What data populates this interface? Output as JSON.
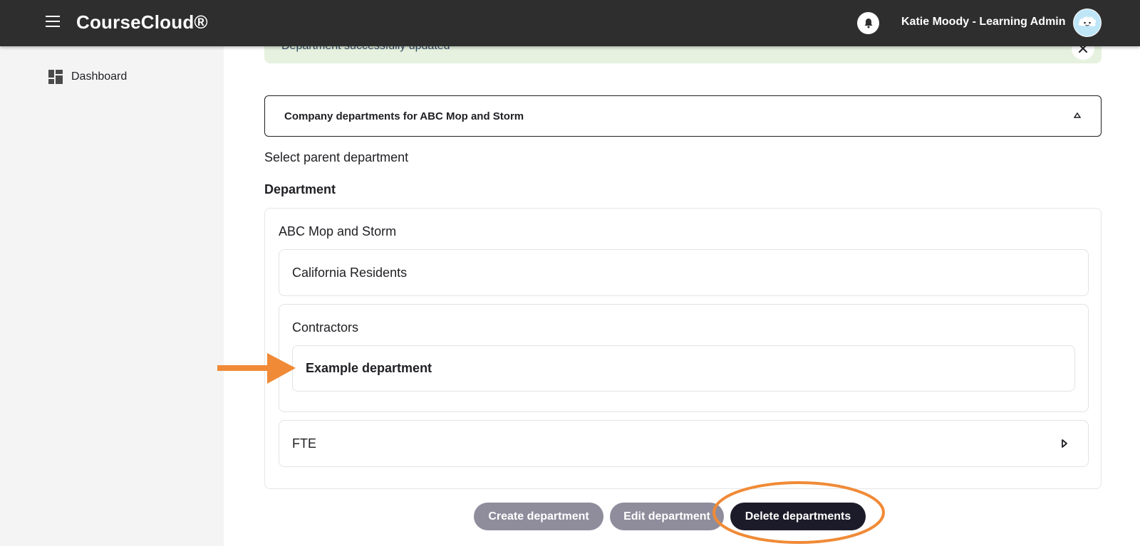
{
  "header": {
    "app_title": "CourseCloud®",
    "user_label": "Katie Moody - Learning Admin",
    "icons": [
      "menu-icon",
      "bell-icon",
      "avatar-icon"
    ]
  },
  "sidebar": {
    "items": [
      {
        "label": "Dashboard",
        "icon": "dashboard-icon"
      }
    ]
  },
  "alert": {
    "message": "Department successfully updated",
    "background": "#e6f2df"
  },
  "accordion": {
    "title": "Company departments for ABC Mop and Storm",
    "state": "expanded"
  },
  "form": {
    "select_parent_label": "Select parent department",
    "department_heading": "Department"
  },
  "tree": {
    "root": "ABC Mop and Storm",
    "children": [
      {
        "label": "California Residents"
      },
      {
        "label": "Contractors",
        "children": [
          {
            "label": "Example department",
            "selected": true
          }
        ]
      },
      {
        "label": "FTE",
        "collapsed": true
      }
    ]
  },
  "actions": {
    "create_label": "Create department",
    "edit_label": "Edit department",
    "delete_label": "Delete departments"
  },
  "colors": {
    "topbar": "#2e2e2e",
    "sidebar": "#f4f4f4",
    "button_muted": "#8f8c9c",
    "button_primary": "#1c1b29",
    "annotation": "#f08a36"
  }
}
